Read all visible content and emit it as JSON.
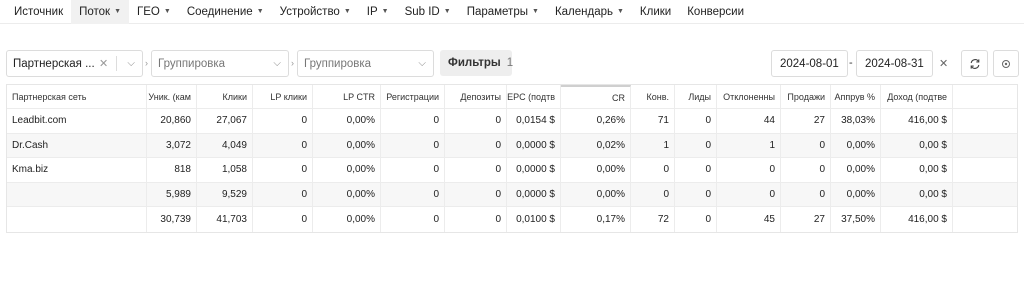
{
  "nav": [
    {
      "label": "Источник",
      "caret": false
    },
    {
      "label": "Поток",
      "caret": true,
      "active": true
    },
    {
      "label": "ГЕО",
      "caret": true
    },
    {
      "label": "Соединение",
      "caret": true
    },
    {
      "label": "Устройство",
      "caret": true
    },
    {
      "label": "IP",
      "caret": true
    },
    {
      "label": "Sub ID",
      "caret": true
    },
    {
      "label": "Параметры",
      "caret": true
    },
    {
      "label": "Календарь",
      "caret": true
    },
    {
      "label": "Клики",
      "caret": false
    },
    {
      "label": "Конверсии",
      "caret": false
    }
  ],
  "filters": {
    "group1_value": "Партнерская ...",
    "group2_placeholder": "Группировка",
    "group3_placeholder": "Группировка",
    "filters_label": "Фильтры",
    "filters_count": "1",
    "date_from": "2024-08-01",
    "date_sep": "-",
    "date_to": "2024-08-31"
  },
  "table": {
    "columns": [
      "Партнерская сеть",
      "Уник. (кам",
      "Клики",
      "LP клики",
      "LP CTR",
      "Регистрации",
      "Депозиты",
      "EPC (подтв",
      "CR",
      "Конв.",
      "Лиды",
      "Отклоненны",
      "Продажи",
      "Аппрув %",
      "Доход (подтве"
    ],
    "rows": [
      [
        "Leadbit.com",
        "20,860",
        "27,067",
        "0",
        "0,00%",
        "0",
        "0",
        "0,0154 $",
        "0,26%",
        "71",
        "0",
        "44",
        "27",
        "38,03%",
        "416,00 $"
      ],
      [
        "Dr.Cash",
        "3,072",
        "4,049",
        "0",
        "0,00%",
        "0",
        "0",
        "0,0000 $",
        "0,02%",
        "1",
        "0",
        "1",
        "0",
        "0,00%",
        "0,00 $"
      ],
      [
        "Kma.biz",
        "818",
        "1,058",
        "0",
        "0,00%",
        "0",
        "0",
        "0,0000 $",
        "0,00%",
        "0",
        "0",
        "0",
        "0",
        "0,00%",
        "0,00 $"
      ],
      [
        "",
        "5,989",
        "9,529",
        "0",
        "0,00%",
        "0",
        "0",
        "0,0000 $",
        "0,00%",
        "0",
        "0",
        "0",
        "0",
        "0,00%",
        "0,00 $"
      ]
    ],
    "total": [
      "",
      "30,739",
      "41,703",
      "0",
      "0,00%",
      "0",
      "0",
      "0,0100 $",
      "0,17%",
      "72",
      "0",
      "45",
      "27",
      "37,50%",
      "416,00 $"
    ]
  }
}
